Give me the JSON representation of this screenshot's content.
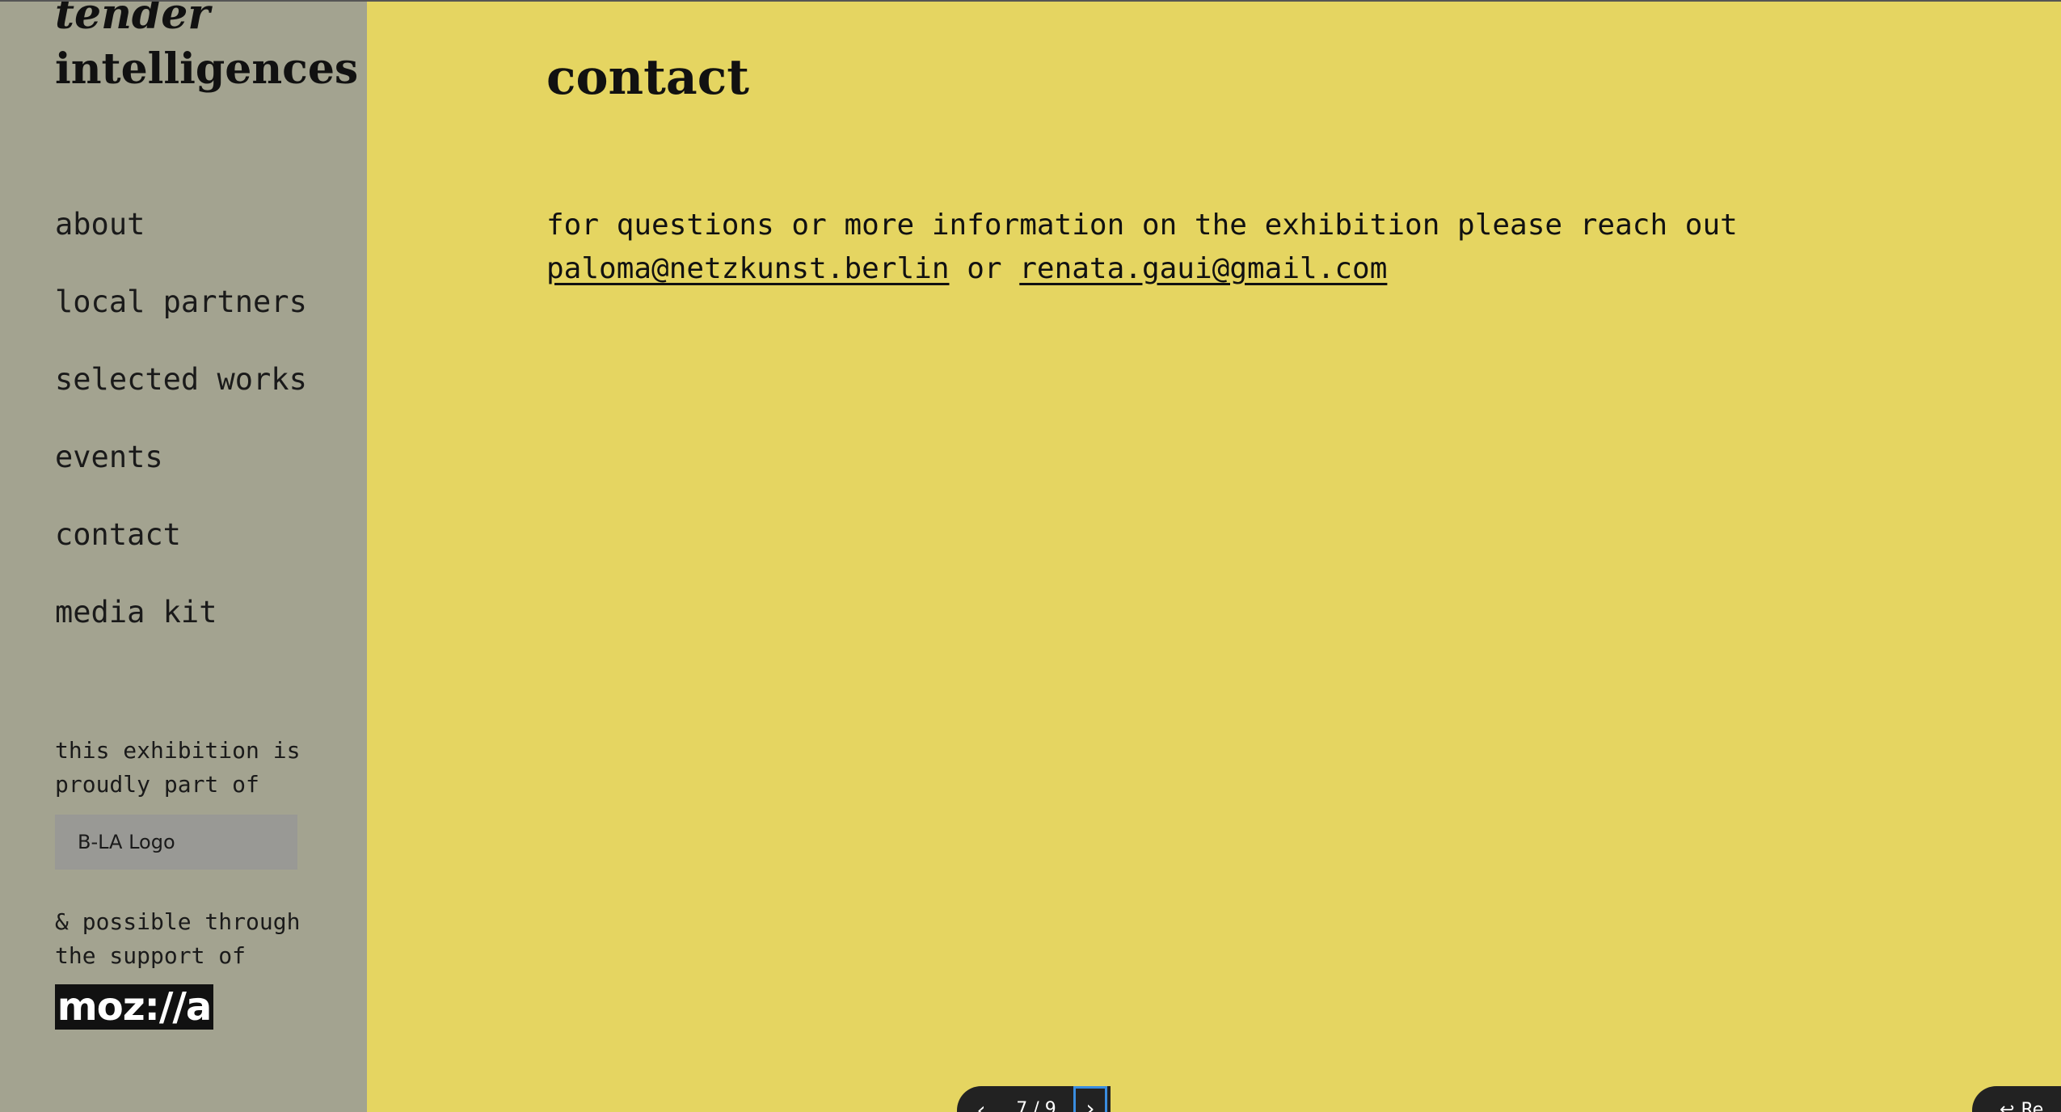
{
  "sidebar": {
    "title_line1": "tender",
    "title_line2": "intelligences",
    "nav": [
      {
        "label": "about"
      },
      {
        "label": "local partners"
      },
      {
        "label": "selected works"
      },
      {
        "label": "events"
      },
      {
        "label": "contact"
      },
      {
        "label": "media kit"
      }
    ],
    "part_of_text": "this exhibition is proudly part of",
    "bla_logo_alt": "B-LA Logo",
    "support_text": "& possible through the support of",
    "mozilla_logo_text": "moz://a"
  },
  "main": {
    "title": "contact",
    "body_text": "for questions or more information on the exhibition please reach out",
    "email_1": "paloma@netzkunst.berlin",
    "connector": "or",
    "email_2": "renata.gaui@gmail.com"
  },
  "pager": {
    "prev_icon": "chevron-left-icon",
    "count": "7 / 9",
    "next_icon": "chevron-right-icon"
  },
  "return_button": {
    "icon": "return-arrow-icon",
    "label": "Re"
  }
}
